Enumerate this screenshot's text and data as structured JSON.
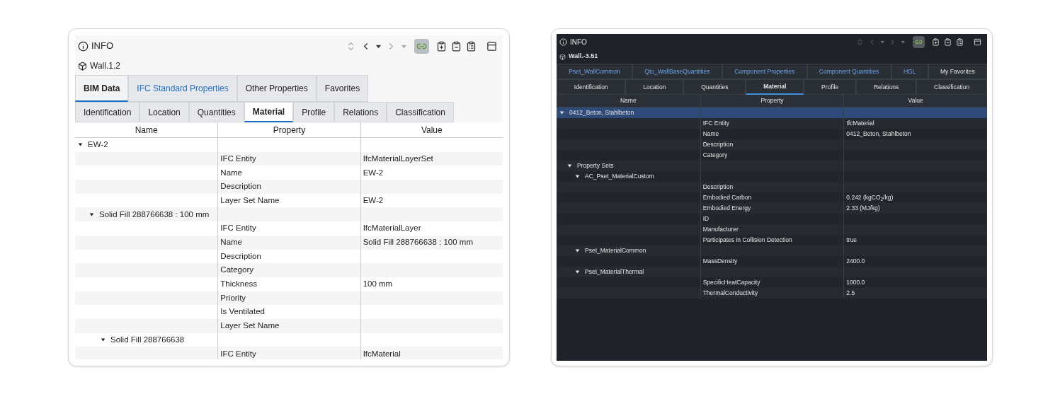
{
  "panels": [
    {
      "kind": "light",
      "title": "INFO",
      "object": "Wall.1.2",
      "toolbar": [
        {
          "kind": "sort",
          "disabled": true
        },
        {
          "kind": "back",
          "disabled": false
        },
        {
          "kind": "back-menu",
          "disabled": false
        },
        {
          "kind": "forward",
          "disabled": true
        },
        {
          "kind": "forward-menu",
          "disabled": true
        },
        {
          "kind": "toggle",
          "selected": true
        },
        {
          "kind": "add"
        },
        {
          "kind": "remove"
        },
        {
          "kind": "list"
        },
        {
          "kind": "window"
        }
      ],
      "tab_rows": [
        [
          {
            "label": "BIM Data",
            "selected": true,
            "highlighted": false
          },
          {
            "label": "IFC Standard Properties",
            "selected": false,
            "highlighted": true
          },
          {
            "label": "Other Properties",
            "selected": false,
            "highlighted": false
          },
          {
            "label": "Favorites",
            "selected": false,
            "highlighted": false
          }
        ],
        [
          {
            "label": "Identification",
            "selected": false,
            "highlighted": false
          },
          {
            "label": "Location",
            "selected": false,
            "highlighted": false
          },
          {
            "label": "Quantities",
            "selected": false,
            "highlighted": false
          },
          {
            "label": "Material",
            "selected": true,
            "highlighted": false
          },
          {
            "label": "Profile",
            "selected": false,
            "highlighted": false
          },
          {
            "label": "Relations",
            "selected": false,
            "highlighted": false
          },
          {
            "label": "Classification",
            "selected": false,
            "highlighted": false
          }
        ]
      ],
      "columns": [
        "Name",
        "Property",
        "Value"
      ],
      "rows": [
        {
          "name": "EW-2",
          "expanded": true,
          "selected": false,
          "children": [
            {
              "property": "IFC Entity",
              "value": "IfcMaterialLayerSet",
              "selected": false
            },
            {
              "property": "Name",
              "value": "EW-2",
              "selected": false
            },
            {
              "property": "Description",
              "selected": false
            },
            {
              "property": "Layer Set Name",
              "value": "EW-2",
              "selected": false
            },
            {
              "name": "Solid Fill 288766638 : 100 mm",
              "expanded": true,
              "selected": false,
              "children": [
                {
                  "property": "IFC Entity",
                  "value": "IfcMaterialLayer",
                  "selected": false
                },
                {
                  "property": "Name",
                  "value": "Solid Fill 288766638 : 100 mm",
                  "selected": false
                },
                {
                  "property": "Description",
                  "selected": false
                },
                {
                  "property": "Category",
                  "selected": false
                },
                {
                  "property": "Thickness",
                  "value": "100 mm",
                  "selected": false
                },
                {
                  "property": "Priority",
                  "selected": false
                },
                {
                  "property": "Is Ventilated",
                  "selected": false
                },
                {
                  "property": "Layer Set Name",
                  "selected": false
                },
                {
                  "name": "Solid Fill 288766638",
                  "expanded": true,
                  "selected": false,
                  "children": [
                    {
                      "property": "IFC Entity",
                      "value": "IfcMaterial",
                      "selected": false
                    }
                  ]
                }
              ]
            }
          ]
        }
      ]
    },
    {
      "kind": "dark",
      "title": "INFO",
      "object": "Wall.-3.51",
      "toolbar": [
        {
          "kind": "sort",
          "disabled": true
        },
        {
          "kind": "back",
          "disabled": true
        },
        {
          "kind": "back-menu",
          "disabled": true
        },
        {
          "kind": "forward",
          "disabled": true
        },
        {
          "kind": "forward-menu",
          "disabled": true
        },
        {
          "kind": "toggle",
          "selected": true
        },
        {
          "kind": "add"
        },
        {
          "kind": "remove"
        },
        {
          "kind": "list"
        },
        {
          "kind": "window"
        }
      ],
      "tab_rows": [
        [
          {
            "label": "Pset_WallCommon",
            "selected": false,
            "highlighted": true
          },
          {
            "label": "Qto_WallBaseQuantities",
            "selected": false,
            "highlighted": true
          },
          {
            "label": "Component Properties",
            "selected": false,
            "highlighted": true
          },
          {
            "label": "Component Quantities",
            "selected": false,
            "highlighted": true
          },
          {
            "label": "HGL",
            "selected": false,
            "highlighted": true
          },
          {
            "label": "My Favorites",
            "selected": false,
            "highlighted": false
          }
        ],
        [
          {
            "label": "Identification",
            "selected": false,
            "highlighted": false
          },
          {
            "label": "Location",
            "selected": false,
            "highlighted": false
          },
          {
            "label": "Quantities",
            "selected": false,
            "highlighted": false
          },
          {
            "label": "Material",
            "selected": true,
            "highlighted": false
          },
          {
            "label": "Profile",
            "selected": false,
            "highlighted": false
          },
          {
            "label": "Relations",
            "selected": false,
            "highlighted": false
          },
          {
            "label": "Classification",
            "selected": false,
            "highlighted": false
          }
        ]
      ],
      "columns": [
        "Name",
        "Property",
        "Value"
      ],
      "rows": [
        {
          "name": "0412_Beton, Stahlbeton",
          "expanded": true,
          "selected": true,
          "children": [
            {
              "property": "IFC Entity",
              "value": "IfcMaterial",
              "selected": false
            },
            {
              "property": "Name",
              "value": "0412_Beton, Stahlbeton",
              "selected": false
            },
            {
              "property": "Description",
              "selected": false
            },
            {
              "property": "Category",
              "selected": false
            },
            {
              "name": "Property Sets",
              "expanded": true,
              "selected": false,
              "children": [
                {
                  "name": "AC_Pset_MaterialCustom",
                  "expanded": true,
                  "selected": false,
                  "children": [
                    {
                      "property": "Description",
                      "selected": false
                    },
                    {
                      "property": "Embodied Carbon",
                      "value": "0.242 (kgCO$_{2}$/kg)",
                      "selected": false
                    },
                    {
                      "property": "Embodied Energy",
                      "value": "2.33 (MJ/kg)",
                      "selected": false
                    },
                    {
                      "property": "ID",
                      "selected": false
                    },
                    {
                      "property": "Manufacturer",
                      "selected": false
                    },
                    {
                      "property": "Participates in Collision Detection",
                      "value": "true",
                      "selected": false
                    }
                  ]
                },
                {
                  "name": "Pset_MaterialCommon",
                  "expanded": true,
                  "selected": false,
                  "children": [
                    {
                      "property": "MassDensity",
                      "value": "2400.0",
                      "selected": false
                    }
                  ]
                },
                {
                  "name": "Pset_MaterialThermal",
                  "expanded": true,
                  "selected": false,
                  "children": [
                    {
                      "property": "SpecificHeatCapacity",
                      "value": "1000.0",
                      "selected": false
                    },
                    {
                      "property": "ThermalConductivity",
                      "value": "2.5",
                      "selected": false
                    }
                  ]
                }
              ]
            }
          ]
        }
      ]
    }
  ]
}
